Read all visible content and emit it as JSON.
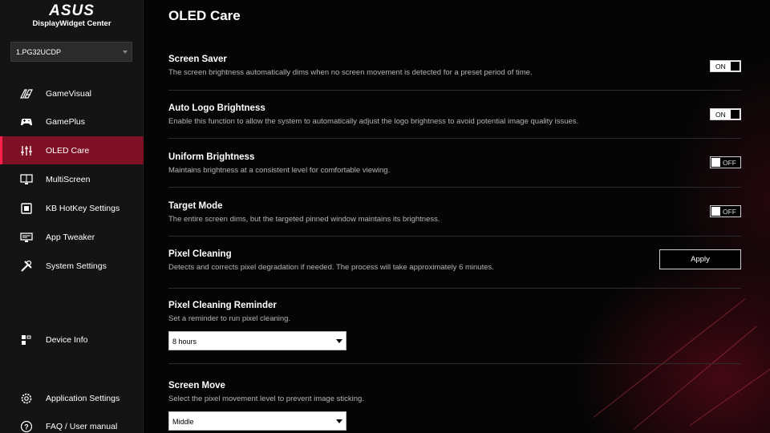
{
  "brand": {
    "logo_text": "ASUS",
    "app_name": "DisplayWidget Center"
  },
  "device": {
    "selected": "1.PG32UCDP"
  },
  "sidebar": {
    "items": [
      {
        "label": "GameVisual",
        "icon": "gamevisual-icon"
      },
      {
        "label": "GamePlus",
        "icon": "gamepad-icon"
      },
      {
        "label": "OLED Care",
        "icon": "sliders-icon",
        "active": true
      },
      {
        "label": "MultiScreen",
        "icon": "multiscreen-icon"
      },
      {
        "label": "KB HotKey Settings",
        "icon": "keyboard-icon"
      },
      {
        "label": "App Tweaker",
        "icon": "app-tweaker-icon"
      },
      {
        "label": "System Settings",
        "icon": "tools-icon"
      }
    ],
    "device_info": {
      "label": "Device Info",
      "icon": "device-info-icon"
    },
    "footer": [
      {
        "label": "Application Settings",
        "icon": "gear-icon"
      },
      {
        "label": "FAQ / User manual",
        "icon": "help-icon"
      }
    ]
  },
  "main": {
    "title": "OLED Care",
    "settings": [
      {
        "title": "Screen Saver",
        "desc": "The screen brightness automatically dims when no screen movement is detected for a preset period of time.",
        "control": "toggle",
        "state": "ON"
      },
      {
        "title": "Auto Logo Brightness",
        "desc": "Enable this function to allow the system to automatically adjust the logo brightness to avoid potential image quality issues.",
        "control": "toggle",
        "state": "ON"
      },
      {
        "title": "Uniform Brightness",
        "desc": "Maintains brightness at a consistent level for comfortable viewing.",
        "control": "toggle",
        "state": "OFF"
      },
      {
        "title": "Target Mode",
        "desc": "The entire screen dims, but the targeted pinned window maintains its brightness.",
        "control": "toggle",
        "state": "OFF"
      },
      {
        "title": "Pixel Cleaning",
        "desc": "Detects and corrects pixel degradation if needed. The process will take approximately 6 minutes.",
        "control": "button",
        "button_label": "Apply"
      },
      {
        "title": "Pixel Cleaning Reminder",
        "desc": "Set a reminder to run pixel cleaning.",
        "control": "dropdown",
        "value": "8 hours"
      },
      {
        "title": "Screen Move",
        "desc": "Select the pixel movement level to prevent image sticking.",
        "control": "dropdown",
        "value": "Middle"
      }
    ]
  },
  "colors": {
    "accent": "#7e1126",
    "accent_edge": "#ff1f4b",
    "sidebar_bg": "#141414",
    "main_bg": "#050505"
  }
}
